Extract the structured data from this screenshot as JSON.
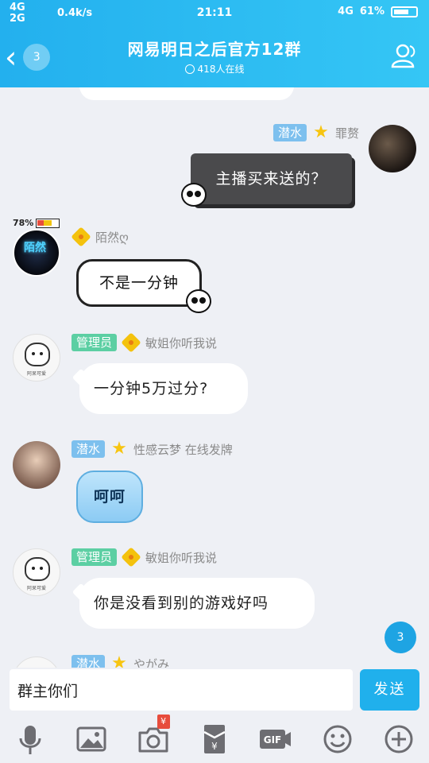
{
  "status_bar": {
    "network_top": "4G",
    "network_bottom": "2G",
    "speed": "0.4k/s",
    "time": "21:11",
    "network_right": "4G",
    "battery": "61%"
  },
  "header": {
    "back_count": "3",
    "title": "网易明日之后官方12群",
    "online": "418人在线",
    "members_icon": "members-icon"
  },
  "messages": [
    {
      "side": "right",
      "tag": "潜水",
      "name": "罪赘",
      "text": "主播买来送的？",
      "style": "dark-bubble"
    },
    {
      "side": "left",
      "name": "陌然ღ",
      "text": "不是一分钟",
      "style": "comic-bubble",
      "avatar_text": "陌然",
      "battery_overlay": "78%"
    },
    {
      "side": "left",
      "tag": "管理员",
      "name": "敏姐你听我说",
      "text": "一分钟5万过分?",
      "avatar_caption": "阿呆可爱"
    },
    {
      "side": "left",
      "tag": "潜水",
      "name": "性感云梦 在线发牌",
      "text": "呵呵",
      "style": "cloud-bubble"
    },
    {
      "side": "left",
      "tag": "管理员",
      "name": "敏姐你听我说",
      "text": "你是没看到别的游戏好吗",
      "avatar_caption": "阿呆可爱"
    },
    {
      "side": "left",
      "tag": "潜水",
      "name": "やがみ",
      "text": ""
    }
  ],
  "unread_badge": "3",
  "composer": {
    "input_value": "群主你们",
    "send_label": "发送"
  },
  "toolbar": {
    "items": [
      "microphone-icon",
      "image-icon",
      "camera-icon",
      "red-packet-icon",
      "gif-icon",
      "emoji-icon",
      "plus-icon"
    ],
    "money_badge": "¥",
    "gif_label": "GIF"
  },
  "colors": {
    "header": "#23b0ee",
    "send": "#20b0ec",
    "tag_dive": "#7dc0ee",
    "tag_admin": "#5ccfa3"
  }
}
